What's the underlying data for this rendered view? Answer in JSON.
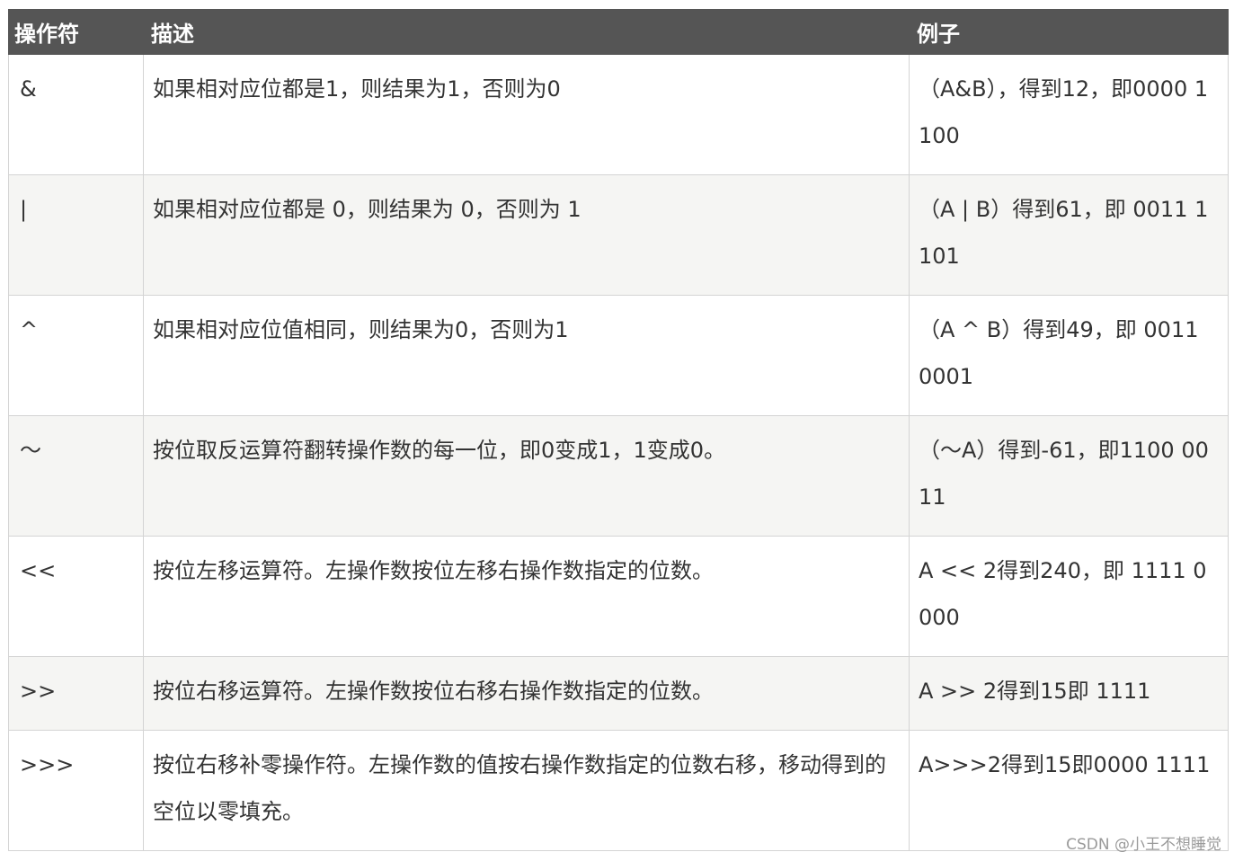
{
  "table": {
    "headers": [
      "操作符",
      "描述",
      "例子"
    ],
    "rows": [
      {
        "op": "&",
        "desc": "如果相对应位都是1，则结果为1，否则为0",
        "example": "（A&B），得到12，即0000 1100"
      },
      {
        "op": "|",
        "desc": "如果相对应位都是 0，则结果为 0，否则为 1",
        "example": "（A | B）得到61，即 0011 1101"
      },
      {
        "op": "^",
        "desc": "如果相对应位值相同，则结果为0，否则为1",
        "example": "（A ^ B）得到49，即 0011 0001"
      },
      {
        "op": "〜",
        "desc": "按位取反运算符翻转操作数的每一位，即0变成1，1变成0。",
        "example": "（〜A）得到-61，即1100 0011"
      },
      {
        "op": "<<",
        "desc": "按位左移运算符。左操作数按位左移右操作数指定的位数。",
        "example": "A << 2得到240，即 1111 0000"
      },
      {
        "op": ">>",
        "desc": "按位右移运算符。左操作数按位右移右操作数指定的位数。",
        "example": "A >> 2得到15即 1111"
      },
      {
        "op": ">>>",
        "desc": "按位右移补零操作符。左操作数的值按右操作数指定的位数右移，移动得到的空位以零填充。",
        "example": "A>>>2得到15即0000 1111"
      }
    ]
  },
  "watermark": "CSDN @小王不想睡觉",
  "colors": {
    "header_bg": "#555555",
    "header_text": "#ffffff",
    "row_alt_bg": "#f5f5f3",
    "border": "#d4d4d4"
  }
}
